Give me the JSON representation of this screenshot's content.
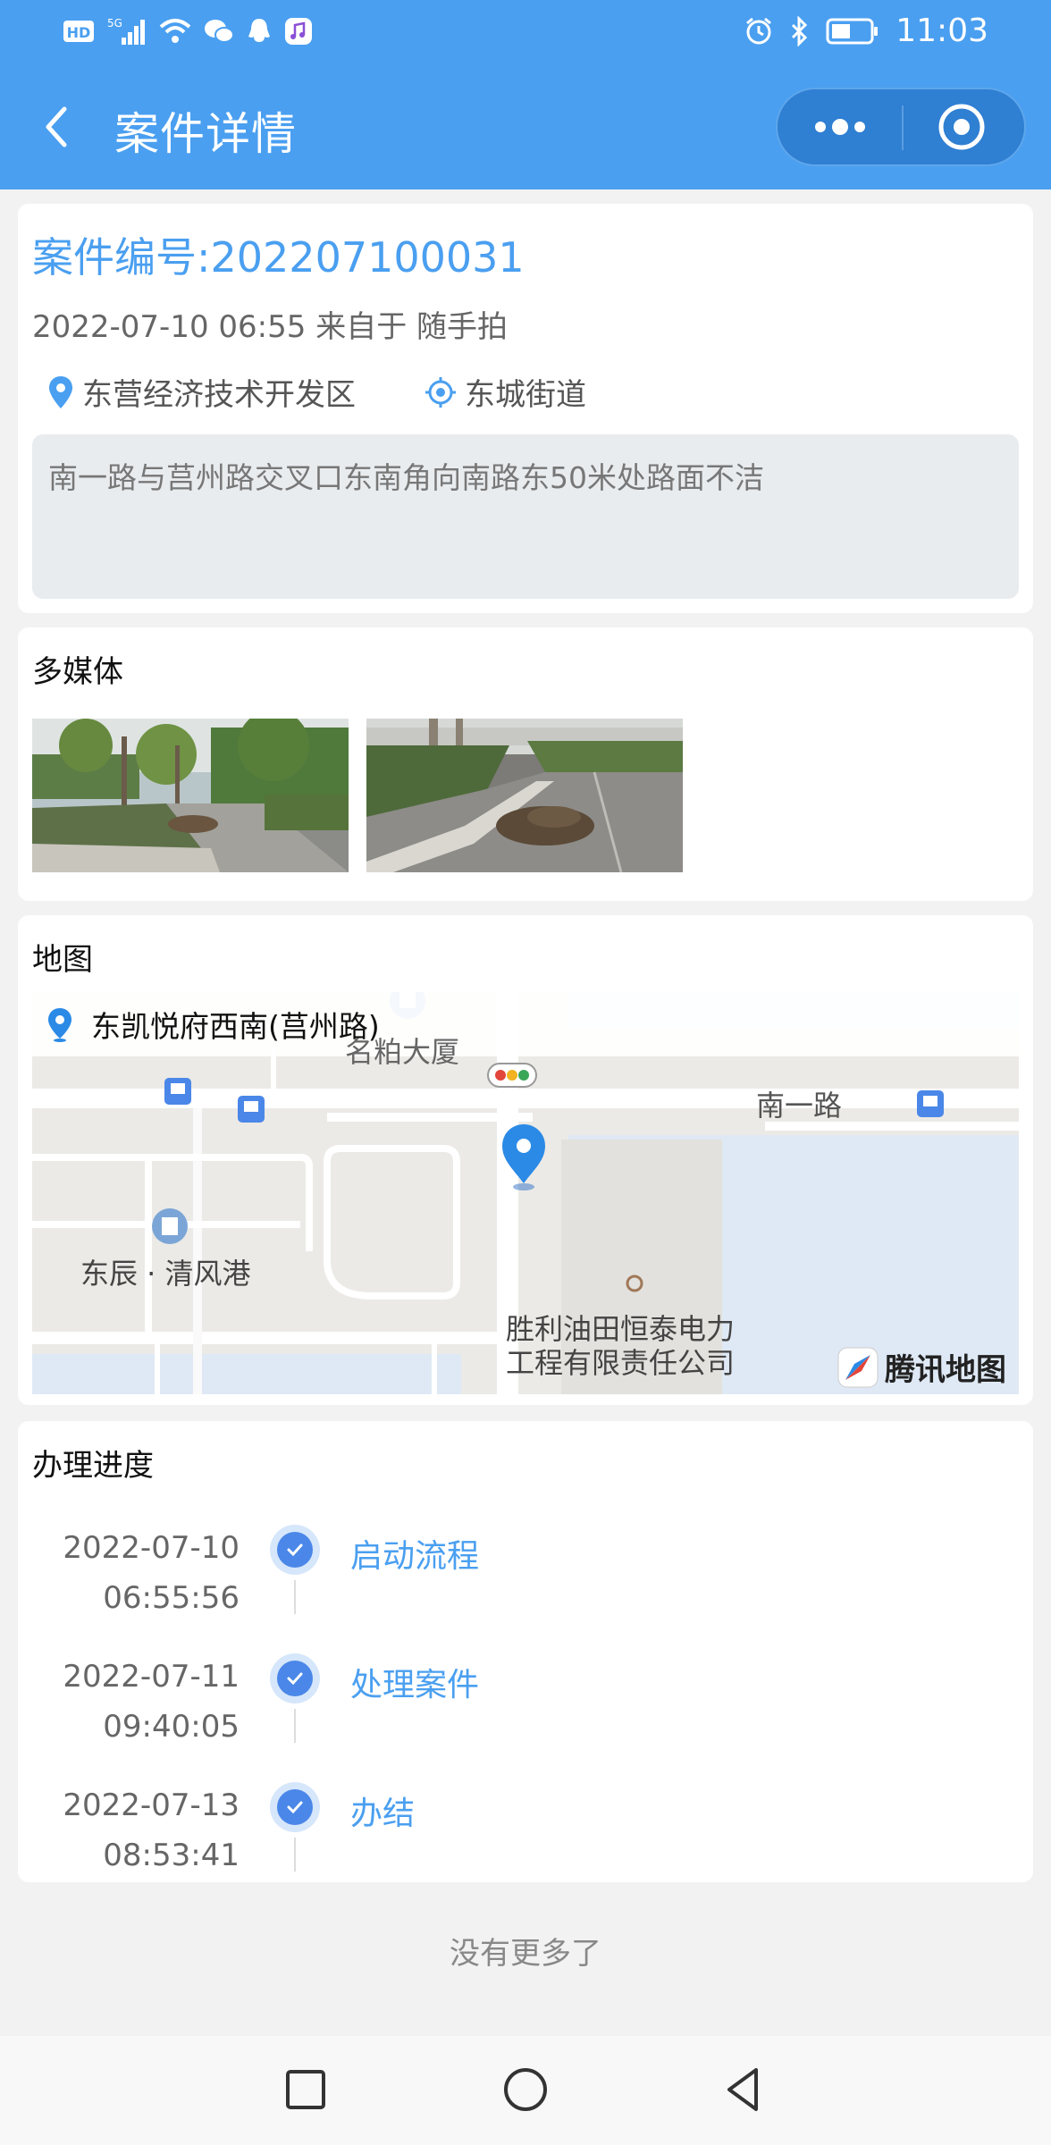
{
  "status_bar": {
    "left_icons": [
      "hd-icon",
      "5g-signal-icon",
      "wifi-icon",
      "wechat-icon",
      "qq-icon",
      "music-icon"
    ],
    "network": "5G",
    "hd": "HD",
    "right_icons": [
      "alarm-icon",
      "bluetooth-icon",
      "battery-icon"
    ],
    "battery_level": 0.5,
    "time": "11:03"
  },
  "nav": {
    "title": "案件详情",
    "back_icon": "chevron-left-icon",
    "more_icon": "more-dots-icon",
    "close_icon": "target-circle-icon"
  },
  "case": {
    "number": "案件编号:202207100031",
    "meta": "2022-07-10 06:55 来自于 随手拍",
    "district": "东营经济技术开发区",
    "street": "东城街道",
    "description": "南一路与莒州路交叉口东南角向南路东50米处路面不洁"
  },
  "media": {
    "title": "多媒体",
    "photos": [
      "road-photo-1",
      "road-photo-2"
    ]
  },
  "map": {
    "title": "地图",
    "location": "东凯悦府西南(莒州路)",
    "labels": {
      "poi1": "名粕大厦",
      "road1": "南一路",
      "poi2": "东辰 · 清风港",
      "poi3_line1": "胜利油田恒泰电力",
      "poi3_line2": "工程有限责任公司"
    },
    "logo": "腾讯地图",
    "colors": {
      "accent": "#4a9ff0",
      "water": "#dfe9f5",
      "road": "#ffffff"
    }
  },
  "progress": {
    "title": "办理进度",
    "steps": [
      {
        "date": "2022-07-10",
        "time": "06:55:56",
        "label": "启动流程"
      },
      {
        "date": "2022-07-11",
        "time": "09:40:05",
        "label": "处理案件"
      },
      {
        "date": "2022-07-13",
        "time": "08:53:41",
        "label": "办结"
      }
    ]
  },
  "footer": {
    "no_more": "没有更多了"
  },
  "system_nav": {
    "buttons": [
      "square-icon",
      "circle-icon",
      "triangle-back-icon"
    ]
  },
  "theme": {
    "primary": "#4a9ff0",
    "background": "#f2f2f2"
  }
}
